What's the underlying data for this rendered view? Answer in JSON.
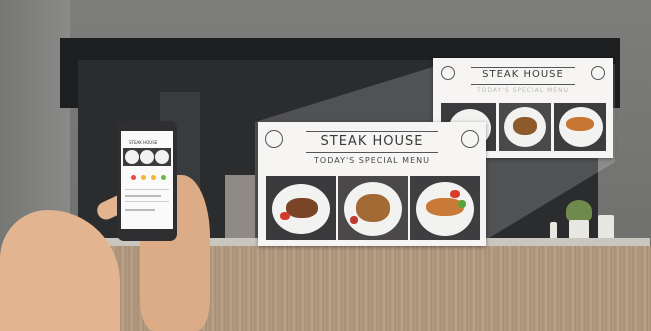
{
  "menu": {
    "title": "STEAK HOUSE",
    "subtitle": "TODAY'S SPECIAL MENU"
  },
  "phone": {
    "screen_title": "STEAK HOUSE"
  },
  "colors": {
    "wall": "#7d7d7b",
    "kitchen": "#2b2c2e",
    "counter": "#b59d84",
    "skin": "#e2b48f",
    "dot_colors": [
      "#e84b3c",
      "#f2b632",
      "#f2b632",
      "#67b64a"
    ]
  }
}
